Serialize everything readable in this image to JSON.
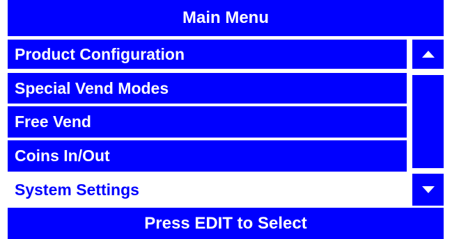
{
  "title": "Main Menu",
  "menu": {
    "items": [
      {
        "label": "Product Configuration"
      },
      {
        "label": "Special Vend Modes"
      },
      {
        "label": "Free Vend"
      },
      {
        "label": "Coins In/Out"
      },
      {
        "label": "System Settings",
        "selected": true
      }
    ]
  },
  "scrollbar": {
    "up_icon": "triangle-up-icon",
    "down_icon": "triangle-down-icon"
  },
  "footer": "Press EDIT to Select",
  "colors": {
    "background": "#ffffff",
    "accent": "#0000ff",
    "text": "#ffffff",
    "selected_text": "#0000ff"
  }
}
